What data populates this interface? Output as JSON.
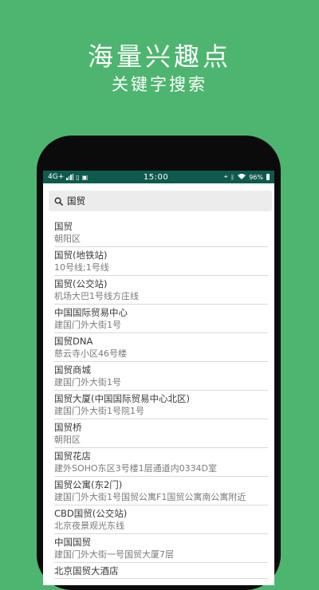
{
  "promo": {
    "headline": "海量兴趣点",
    "subheadline": "关键字搜索"
  },
  "status_bar": {
    "network": "4G+",
    "time": "15:00",
    "battery": "96%"
  },
  "search": {
    "query": "国贸"
  },
  "results": [
    {
      "name": "国贸",
      "address": "朝阳区"
    },
    {
      "name": "国贸(地铁站)",
      "address": "10号线;1号线"
    },
    {
      "name": "国贸(公交站)",
      "address": "机场大巴1号线方庄线"
    },
    {
      "name": "中国国际贸易中心",
      "address": "建国门外大街1号"
    },
    {
      "name": "国贸DNA",
      "address": "慈云寺小区46号楼"
    },
    {
      "name": "国贸商城",
      "address": "建国门外大街1号"
    },
    {
      "name": "国贸大厦(中国国际贸易中心北区)",
      "address": "建国门外大街1号院1号"
    },
    {
      "name": "国贸桥",
      "address": "朝阳区"
    },
    {
      "name": "国贸花店",
      "address": "建外SOHO东区3号楼1层通道内0334D室"
    },
    {
      "name": "国贸公寓(东2门)",
      "address": "建国门外大街1号国贸公寓F1国贸公寓南公寓附近"
    },
    {
      "name": "CBD国贸(公交站)",
      "address": "北京夜景观光东线"
    },
    {
      "name": "中国国贸",
      "address": "建国门外大街一号国贸大厦7层"
    },
    {
      "name": "北京国贸大酒店",
      "address": ""
    }
  ]
}
